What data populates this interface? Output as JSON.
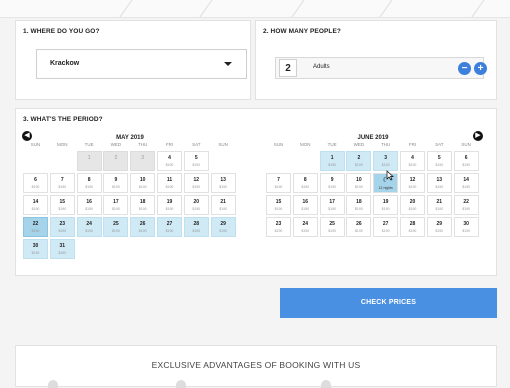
{
  "destination": {
    "title": "1. WHERE DO YOU GO?",
    "selected": "Krackow"
  },
  "people": {
    "title": "2. HOW MANY PEOPLE?",
    "count": "2",
    "label": "Adults",
    "minus": "−",
    "plus": "+"
  },
  "period": {
    "title": "3. WHAT'S THE PERIOD?",
    "prev": "◀",
    "next": "▶",
    "weekdays": [
      "SUN",
      "MON",
      "TUE",
      "WED",
      "THU",
      "FRI",
      "SAT",
      "SUN"
    ],
    "months": [
      {
        "title": "MAY 2019",
        "weeks": [
          [
            null,
            null,
            {
              "d": "1",
              "p": "",
              "s": "disabled"
            },
            {
              "d": "2",
              "p": "",
              "s": "disabled"
            },
            {
              "d": "3",
              "p": "",
              "s": "disabled"
            },
            {
              "d": "4",
              "p": "$190"
            },
            {
              "d": "5",
              "p": "$190"
            }
          ],
          [
            {
              "d": "6",
              "p": "$190"
            },
            {
              "d": "7",
              "p": "$190"
            },
            {
              "d": "8",
              "p": "$190"
            },
            {
              "d": "9",
              "p": "$190"
            },
            {
              "d": "10",
              "p": "$190"
            },
            {
              "d": "11",
              "p": "$190"
            },
            {
              "d": "12",
              "p": "$190"
            },
            {
              "d": "13",
              "p": "$190"
            }
          ],
          [
            {
              "d": "14",
              "p": "$190"
            },
            {
              "d": "15",
              "p": "$190"
            },
            {
              "d": "16",
              "p": "$190"
            },
            {
              "d": "17",
              "p": "$190"
            },
            {
              "d": "18",
              "p": "$190"
            },
            {
              "d": "19",
              "p": "$190"
            },
            {
              "d": "20",
              "p": "$190"
            },
            {
              "d": "21",
              "p": "$190"
            }
          ],
          [
            {
              "d": "22",
              "p": "$190",
              "s": "sel"
            },
            {
              "d": "23",
              "p": "$190",
              "s": "hl"
            },
            {
              "d": "24",
              "p": "$190",
              "s": "hl"
            },
            {
              "d": "25",
              "p": "$190",
              "s": "hl"
            },
            {
              "d": "26",
              "p": "$190",
              "s": "hl"
            },
            {
              "d": "27",
              "p": "$190",
              "s": "hl"
            },
            {
              "d": "28",
              "p": "$190",
              "s": "hl"
            },
            {
              "d": "29",
              "p": "$190",
              "s": "hl"
            }
          ],
          [
            {
              "d": "30",
              "p": "$190",
              "s": "hl"
            },
            {
              "d": "31",
              "p": "$190",
              "s": "hl"
            }
          ]
        ]
      },
      {
        "title": "JUNE 2019",
        "weeks": [
          [
            null,
            null,
            {
              "d": "1",
              "p": "$190",
              "s": "hl"
            },
            {
              "d": "2",
              "p": "$190",
              "s": "hl"
            },
            {
              "d": "3",
              "p": "$190",
              "s": "hl"
            },
            {
              "d": "4",
              "p": "$190"
            },
            {
              "d": "5",
              "p": "$190"
            },
            {
              "d": "6",
              "p": "$190"
            }
          ],
          [
            {
              "d": "7",
              "p": "$190"
            },
            {
              "d": "8",
              "p": "$190"
            },
            {
              "d": "9",
              "p": "$190"
            },
            {
              "d": "10",
              "p": "$190"
            },
            {
              "d": "",
              "p": "",
              "s": "nights",
              "nights": "12 nights"
            },
            {
              "d": "12",
              "p": "$190"
            },
            {
              "d": "13",
              "p": "$190"
            },
            {
              "d": "14",
              "p": "$190"
            }
          ],
          [
            {
              "d": "15",
              "p": "$190"
            },
            {
              "d": "16",
              "p": "$190"
            },
            {
              "d": "17",
              "p": "$190"
            },
            {
              "d": "18",
              "p": "$190"
            },
            {
              "d": "19",
              "p": "$190"
            },
            {
              "d": "20",
              "p": "$190"
            },
            {
              "d": "21",
              "p": "$190"
            },
            {
              "d": "22",
              "p": "$190"
            }
          ],
          [
            {
              "d": "23",
              "p": "$190"
            },
            {
              "d": "24",
              "p": "$190"
            },
            {
              "d": "25",
              "p": "$190"
            },
            {
              "d": "26",
              "p": "$190"
            },
            {
              "d": "27",
              "p": "$190"
            },
            {
              "d": "28",
              "p": "$190"
            },
            {
              "d": "29",
              "p": "$190"
            },
            {
              "d": "30",
              "p": "$190"
            }
          ]
        ]
      }
    ]
  },
  "actions": {
    "check_prices": "CHECK PRICES"
  },
  "advantages": {
    "title": "EXCLUSIVE ADVANTAGES OF BOOKING WITH US"
  },
  "icons": {
    "moon": "moon-icon",
    "cursor": "cursor-icon",
    "chevron_down": "chevron-down-icon"
  },
  "colors": {
    "accent": "#4a90e2",
    "selected": "#a5d3ea",
    "range": "#cfe9f5"
  }
}
